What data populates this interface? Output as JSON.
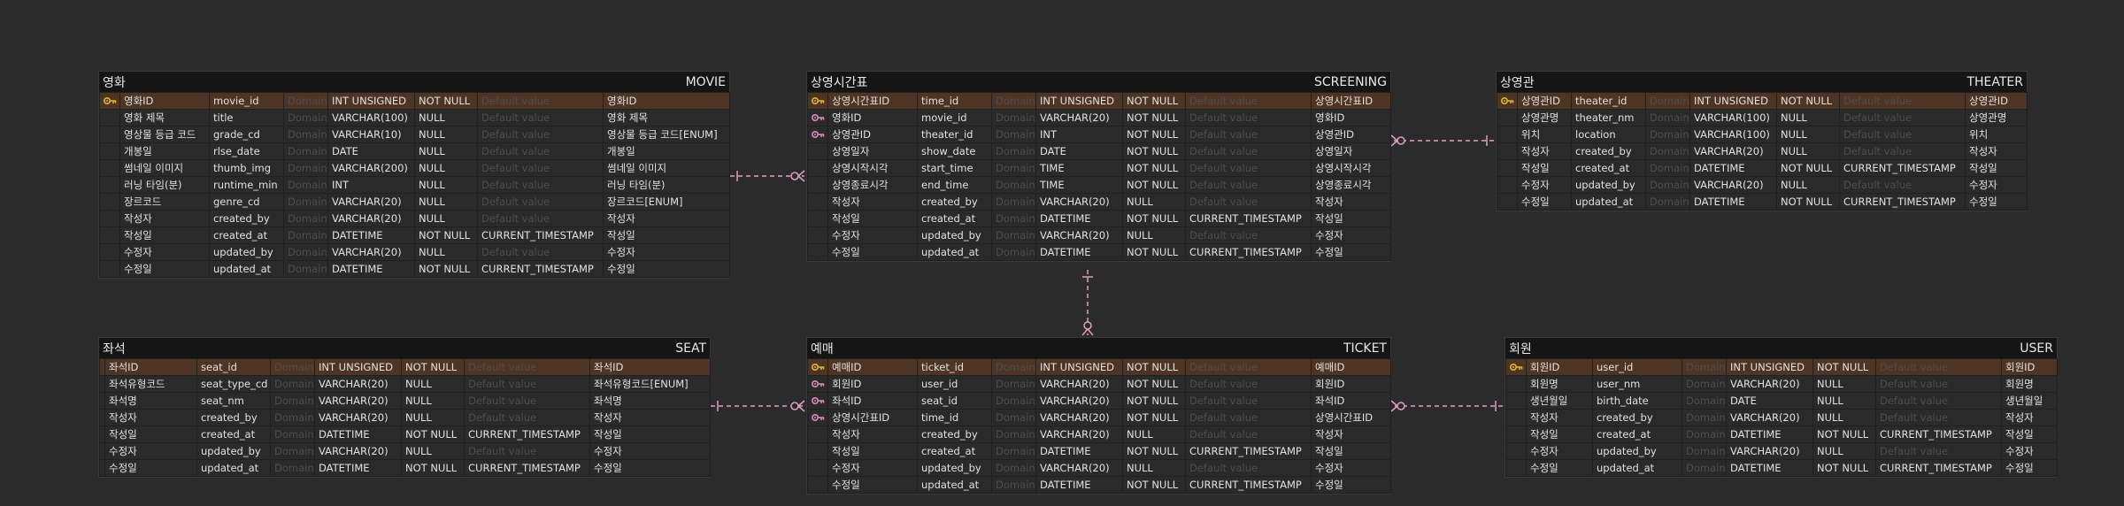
{
  "placeholders": {
    "domain": "Domain",
    "default": "Default value"
  },
  "colors": {
    "pk_key": "#e0b830",
    "fk_key": "#d890b8",
    "relation": "#e0a0c0",
    "pk_row": "#4e3422"
  },
  "entities": [
    {
      "id": "movie",
      "logical": "영화",
      "physical": "MOVIE",
      "attrs": [
        {
          "key": "pk",
          "lname": "영화ID",
          "pname": "movie_id",
          "type": "INT UNSIGNED",
          "nullable": "NOT NULL",
          "default": "",
          "comment": "영화ID"
        },
        {
          "key": "",
          "lname": "영화 제목",
          "pname": "title",
          "type": "VARCHAR(100)",
          "nullable": "NULL",
          "default": "",
          "comment": "영화 제목"
        },
        {
          "key": "",
          "lname": "영상물 등급 코드",
          "pname": "grade_cd",
          "type": "VARCHAR(10)",
          "nullable": "NULL",
          "default": "",
          "comment": "영상물 등급 코드[ENUM]"
        },
        {
          "key": "",
          "lname": "개봉일",
          "pname": "rlse_date",
          "type": "DATE",
          "nullable": "NULL",
          "default": "",
          "comment": "개봉일"
        },
        {
          "key": "",
          "lname": "썸네일 이미지",
          "pname": "thumb_img",
          "type": "VARCHAR(200)",
          "nullable": "NULL",
          "default": "",
          "comment": "썸네일 이미지"
        },
        {
          "key": "",
          "lname": "러닝 타임(분)",
          "pname": "runtime_min",
          "type": "INT",
          "nullable": "NULL",
          "default": "",
          "comment": "러닝 타임(분)"
        },
        {
          "key": "",
          "lname": "장르코드",
          "pname": "genre_cd",
          "type": "VARCHAR(20)",
          "nullable": "NULL",
          "default": "",
          "comment": "장르코드[ENUM]"
        },
        {
          "key": "",
          "lname": "작성자",
          "pname": "created_by",
          "type": "VARCHAR(20)",
          "nullable": "NULL",
          "default": "",
          "comment": "작성자"
        },
        {
          "key": "",
          "lname": "작성일",
          "pname": "created_at",
          "type": "DATETIME",
          "nullable": "NOT NULL",
          "default": "CURRENT_TIMESTAMP",
          "comment": "작성일"
        },
        {
          "key": "",
          "lname": "수정자",
          "pname": "updated_by",
          "type": "VARCHAR(20)",
          "nullable": "NULL",
          "default": "",
          "comment": "수정자"
        },
        {
          "key": "",
          "lname": "수정일",
          "pname": "updated_at",
          "type": "DATETIME",
          "nullable": "NOT NULL",
          "default": "CURRENT_TIMESTAMP",
          "comment": "수정일"
        }
      ]
    },
    {
      "id": "screening",
      "logical": "상영시간표",
      "physical": "SCREENING",
      "attrs": [
        {
          "key": "pk",
          "lname": "상영시간표ID",
          "pname": "time_id",
          "type": "INT UNSIGNED",
          "nullable": "NOT NULL",
          "default": "",
          "comment": "상영시간표ID"
        },
        {
          "key": "fk",
          "lname": "영화ID",
          "pname": "movie_id",
          "type": "VARCHAR(20)",
          "nullable": "NOT NULL",
          "default": "",
          "comment": "영화ID"
        },
        {
          "key": "fk",
          "lname": "상영관ID",
          "pname": "theater_id",
          "type": "INT",
          "nullable": "NOT NULL",
          "default": "",
          "comment": "상영관ID"
        },
        {
          "key": "",
          "lname": "상영일자",
          "pname": "show_date",
          "type": "DATE",
          "nullable": "NOT NULL",
          "default": "",
          "comment": "상영일자"
        },
        {
          "key": "",
          "lname": "상영시작시각",
          "pname": "start_time",
          "type": "TIME",
          "nullable": "NOT NULL",
          "default": "",
          "comment": "상영시작시각"
        },
        {
          "key": "",
          "lname": "상영종료시각",
          "pname": "end_time",
          "type": "TIME",
          "nullable": "NOT NULL",
          "default": "",
          "comment": "상영종료시각"
        },
        {
          "key": "",
          "lname": "작성자",
          "pname": "created_by",
          "type": "VARCHAR(20)",
          "nullable": "NULL",
          "default": "",
          "comment": "작성자"
        },
        {
          "key": "",
          "lname": "작성일",
          "pname": "created_at",
          "type": "DATETIME",
          "nullable": "NOT NULL",
          "default": "CURRENT_TIMESTAMP",
          "comment": "작성일"
        },
        {
          "key": "",
          "lname": "수정자",
          "pname": "updated_by",
          "type": "VARCHAR(20)",
          "nullable": "NULL",
          "default": "",
          "comment": "수정자"
        },
        {
          "key": "",
          "lname": "수정일",
          "pname": "updated_at",
          "type": "DATETIME",
          "nullable": "NOT NULL",
          "default": "CURRENT_TIMESTAMP",
          "comment": "수정일"
        }
      ]
    },
    {
      "id": "theater",
      "logical": "상영관",
      "physical": "THEATER",
      "attrs": [
        {
          "key": "pk",
          "lname": "상영관ID",
          "pname": "theater_id",
          "type": "INT UNSIGNED",
          "nullable": "NOT NULL",
          "default": "",
          "comment": "상영관ID"
        },
        {
          "key": "",
          "lname": "상영관명",
          "pname": "theater_nm",
          "type": "VARCHAR(100)",
          "nullable": "NULL",
          "default": "",
          "comment": "상영관명"
        },
        {
          "key": "",
          "lname": "위치",
          "pname": "location",
          "type": "VARCHAR(100)",
          "nullable": "NULL",
          "default": "",
          "comment": "위치"
        },
        {
          "key": "",
          "lname": "작성자",
          "pname": "created_by",
          "type": "VARCHAR(20)",
          "nullable": "NULL",
          "default": "",
          "comment": "작성자"
        },
        {
          "key": "",
          "lname": "작성일",
          "pname": "created_at",
          "type": "DATETIME",
          "nullable": "NOT NULL",
          "default": "CURRENT_TIMESTAMP",
          "comment": "작성일"
        },
        {
          "key": "",
          "lname": "수정자",
          "pname": "updated_by",
          "type": "VARCHAR(20)",
          "nullable": "NULL",
          "default": "",
          "comment": "수정자"
        },
        {
          "key": "",
          "lname": "수정일",
          "pname": "updated_at",
          "type": "DATETIME",
          "nullable": "NOT NULL",
          "default": "CURRENT_TIMESTAMP",
          "comment": "수정일"
        }
      ]
    },
    {
      "id": "seat",
      "logical": "좌석",
      "physical": "SEAT",
      "attrs": [
        {
          "key": "",
          "lname": "좌석ID",
          "pname": "seat_id",
          "type": "INT UNSIGNED",
          "nullable": "NOT NULL",
          "default": "",
          "comment": "좌석ID",
          "highlight": true
        },
        {
          "key": "",
          "lname": "좌석유형코드",
          "pname": "seat_type_cd",
          "type": "VARCHAR(20)",
          "nullable": "NULL",
          "default": "",
          "comment": "좌석유형코드[ENUM]"
        },
        {
          "key": "",
          "lname": "좌석명",
          "pname": "seat_nm",
          "type": "VARCHAR(20)",
          "nullable": "NULL",
          "default": "",
          "comment": "좌석명"
        },
        {
          "key": "",
          "lname": "작성자",
          "pname": "created_by",
          "type": "VARCHAR(20)",
          "nullable": "NULL",
          "default": "",
          "comment": "작성자"
        },
        {
          "key": "",
          "lname": "작성일",
          "pname": "created_at",
          "type": "DATETIME",
          "nullable": "NOT NULL",
          "default": "CURRENT_TIMESTAMP",
          "comment": "작성일"
        },
        {
          "key": "",
          "lname": "수정자",
          "pname": "updated_by",
          "type": "VARCHAR(20)",
          "nullable": "NULL",
          "default": "",
          "comment": "수정자"
        },
        {
          "key": "",
          "lname": "수정일",
          "pname": "updated_at",
          "type": "DATETIME",
          "nullable": "NOT NULL",
          "default": "CURRENT_TIMESTAMP",
          "comment": "수정일"
        }
      ]
    },
    {
      "id": "ticket",
      "logical": "예매",
      "physical": "TICKET",
      "attrs": [
        {
          "key": "pk",
          "lname": "예매ID",
          "pname": "ticket_id",
          "type": "INT UNSIGNED",
          "nullable": "NOT NULL",
          "default": "",
          "comment": "예매ID"
        },
        {
          "key": "fk",
          "lname": "회원ID",
          "pname": "user_id",
          "type": "VARCHAR(20)",
          "nullable": "NOT NULL",
          "default": "",
          "comment": "회원ID"
        },
        {
          "key": "fk",
          "lname": "좌석ID",
          "pname": "seat_id",
          "type": "VARCHAR(20)",
          "nullable": "NOT NULL",
          "default": "",
          "comment": "좌석ID"
        },
        {
          "key": "fk",
          "lname": "상영시간표ID",
          "pname": "time_id",
          "type": "VARCHAR(20)",
          "nullable": "NOT NULL",
          "default": "",
          "comment": "상영시간표ID"
        },
        {
          "key": "",
          "lname": "작성자",
          "pname": "created_by",
          "type": "VARCHAR(20)",
          "nullable": "NULL",
          "default": "",
          "comment": "작성자"
        },
        {
          "key": "",
          "lname": "작성일",
          "pname": "created_at",
          "type": "DATETIME",
          "nullable": "NOT NULL",
          "default": "CURRENT_TIMESTAMP",
          "comment": "작성일"
        },
        {
          "key": "",
          "lname": "수정자",
          "pname": "updated_by",
          "type": "VARCHAR(20)",
          "nullable": "NULL",
          "default": "",
          "comment": "수정자"
        },
        {
          "key": "",
          "lname": "수정일",
          "pname": "updated_at",
          "type": "DATETIME",
          "nullable": "NOT NULL",
          "default": "CURRENT_TIMESTAMP",
          "comment": "수정일"
        }
      ]
    },
    {
      "id": "user",
      "logical": "회원",
      "physical": "USER",
      "attrs": [
        {
          "key": "pk",
          "lname": "회원ID",
          "pname": "user_id",
          "type": "INT UNSIGNED",
          "nullable": "NOT NULL",
          "default": "",
          "comment": "회원ID"
        },
        {
          "key": "",
          "lname": "회원명",
          "pname": "user_nm",
          "type": "VARCHAR(20)",
          "nullable": "NULL",
          "default": "",
          "comment": "회원명"
        },
        {
          "key": "",
          "lname": "생년월일",
          "pname": "birth_date",
          "type": "DATE",
          "nullable": "NULL",
          "default": "",
          "comment": "생년월일"
        },
        {
          "key": "",
          "lname": "작성자",
          "pname": "created_by",
          "type": "VARCHAR(20)",
          "nullable": "NULL",
          "default": "",
          "comment": "작성자"
        },
        {
          "key": "",
          "lname": "작성일",
          "pname": "created_at",
          "type": "DATETIME",
          "nullable": "NOT NULL",
          "default": "CURRENT_TIMESTAMP",
          "comment": "작성일"
        },
        {
          "key": "",
          "lname": "수정자",
          "pname": "updated_by",
          "type": "VARCHAR(20)",
          "nullable": "NULL",
          "default": "",
          "comment": "수정자"
        },
        {
          "key": "",
          "lname": "수정일",
          "pname": "updated_at",
          "type": "DATETIME",
          "nullable": "NOT NULL",
          "default": "CURRENT_TIMESTAMP",
          "comment": "수정일"
        }
      ]
    }
  ],
  "relations": [
    {
      "parent": "movie",
      "child": "screening"
    },
    {
      "parent": "theater",
      "child": "screening"
    },
    {
      "parent": "screening",
      "child": "ticket"
    },
    {
      "parent": "seat",
      "child": "ticket"
    },
    {
      "parent": "user",
      "child": "ticket"
    }
  ]
}
